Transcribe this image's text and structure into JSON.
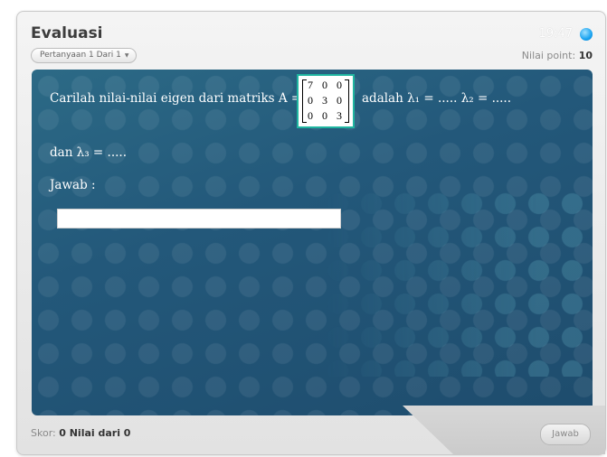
{
  "header": {
    "title": "Evaluasi",
    "question_selector": "Pertanyaan 1 Dari 1",
    "time": "19:47",
    "points_label": "Nilai point:",
    "points_value": "10"
  },
  "question": {
    "line1_before": "Carilah nilai-nilai eigen dari matriks A =",
    "line1_after": "adalah λ₁ = ..... λ₂ = .....",
    "line2": "dan  λ₃ = .....",
    "answer_label": "Jawab :",
    "matrix": [
      [
        "7",
        "0",
        "0"
      ],
      [
        "0",
        "3",
        "0"
      ],
      [
        "0",
        "0",
        "3"
      ]
    ],
    "answer_value": ""
  },
  "footer": {
    "score_label": "Skor:",
    "score_value": "0 Nilai dari 0",
    "submit_label": "Jawab"
  },
  "colors": {
    "panel": "#23587a",
    "accent_dot": "#1aa3f0",
    "matrix_border": "#1fb5a0"
  }
}
